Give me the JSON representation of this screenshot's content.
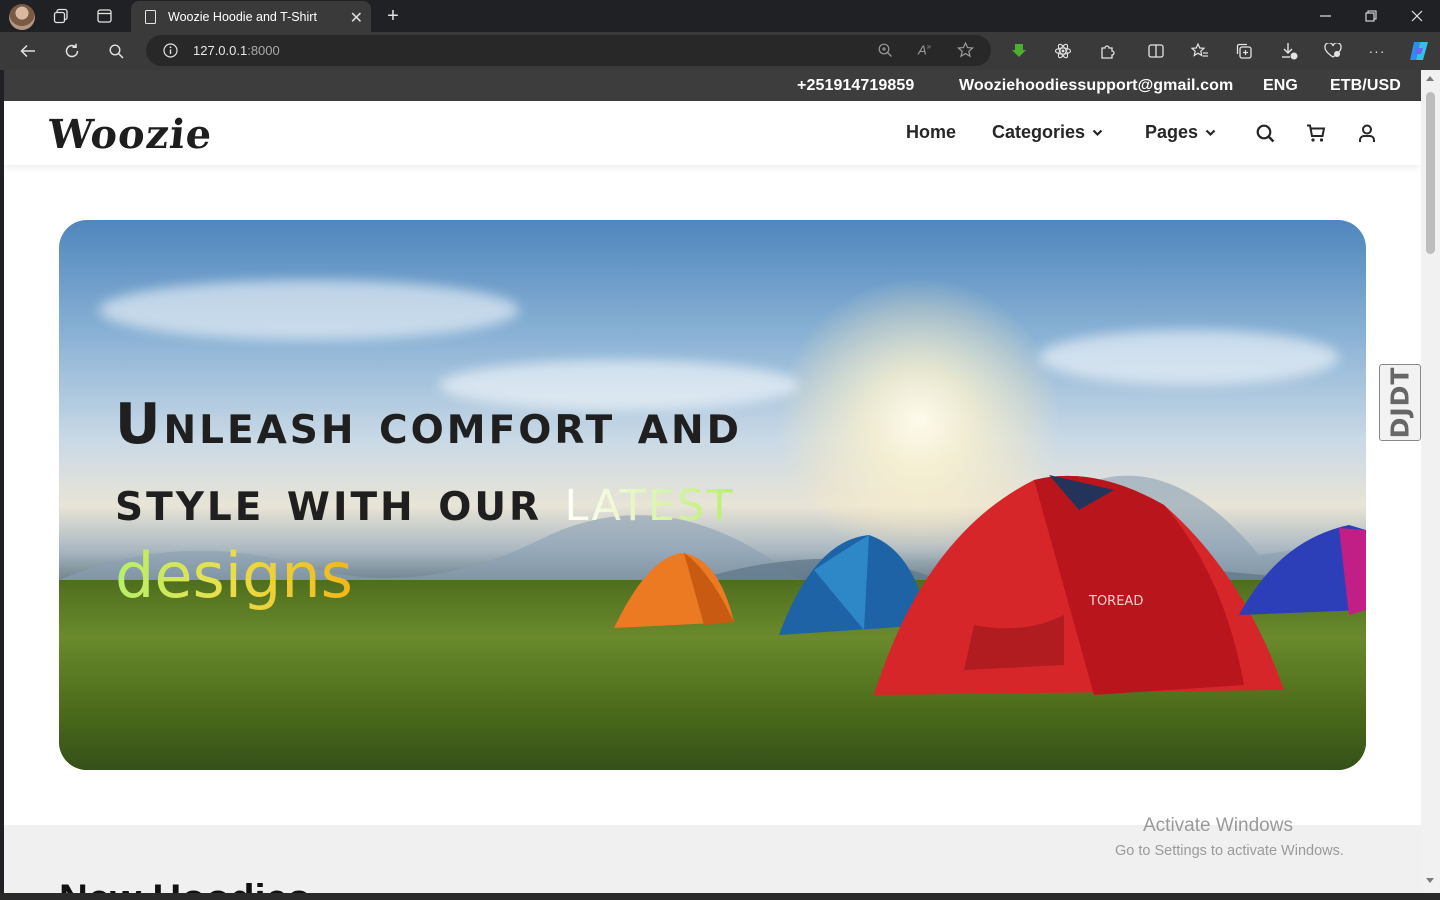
{
  "browser": {
    "tab_title": "Woozie Hoodie and T-Shirt",
    "url_host": "127.0.0.1",
    "url_port": ":8000"
  },
  "topbar": {
    "phone": "+251914719859",
    "email": "Wooziehoodiessupport@gmail.com",
    "language": "ENG",
    "currency": "ETB/USD"
  },
  "navbar": {
    "logo": "Woozie",
    "items": [
      {
        "label": "Home"
      },
      {
        "label": "Categories"
      },
      {
        "label": "Pages"
      }
    ]
  },
  "hero": {
    "line1": "Unleash comfort and",
    "line2": "style with our",
    "highlight1": "latest",
    "highlight2": "designs",
    "tent_brand": "TOREAD"
  },
  "section": {
    "heading": "New Hoodies"
  },
  "side_tab": {
    "label": "DJDT"
  },
  "watermark": {
    "title": "Activate Windows",
    "subtitle": "Go to Settings to activate Windows."
  },
  "colors": {
    "topbar_bg": "#3d3d3d",
    "accent_green": "#b7f06a",
    "accent_orange": "#f2b716"
  }
}
